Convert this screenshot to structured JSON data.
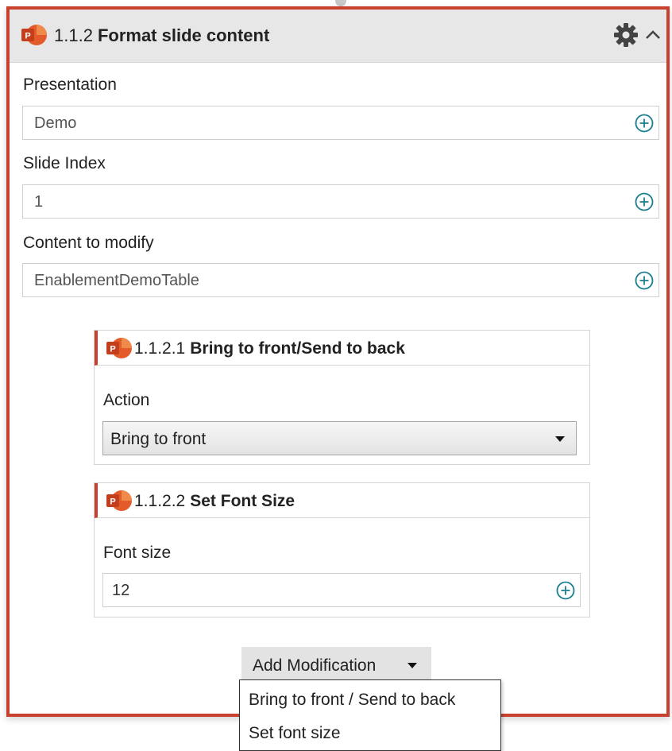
{
  "block": {
    "number": "1.1.2",
    "title": "Format slide content",
    "icon": "powerpoint-icon"
  },
  "fields": {
    "presentation": {
      "label": "Presentation",
      "value": "Demo"
    },
    "slide_index": {
      "label": "Slide Index",
      "value": "1"
    },
    "content": {
      "label": "Content to modify",
      "value": "EnablementDemoTable"
    }
  },
  "sub1": {
    "number": "1.1.2.1",
    "title": "Bring to front/Send to back",
    "label": "Action",
    "value": "Bring to front"
  },
  "sub2": {
    "number": "1.1.2.2",
    "title": "Set Font Size",
    "label": "Font size",
    "value": "12"
  },
  "add_button": {
    "label": "Add Modification"
  },
  "menu": {
    "items": [
      "Bring to front / Send to back",
      "Set font size"
    ]
  },
  "colors": {
    "accent": "#c8412e",
    "plus_icon": "#1a7f8e"
  }
}
